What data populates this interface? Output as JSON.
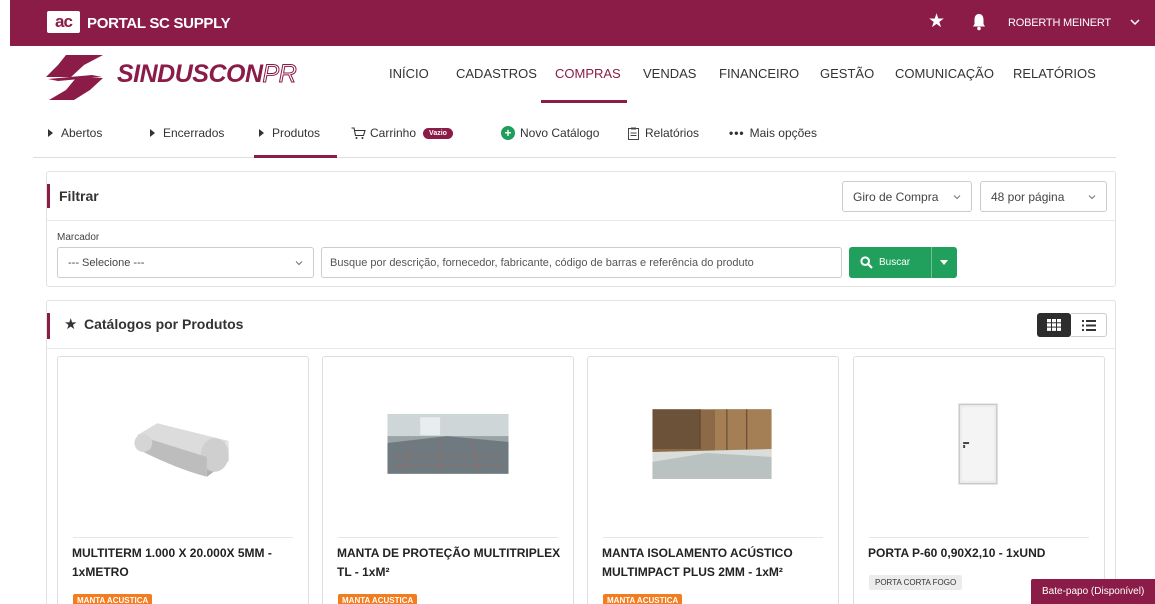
{
  "topbar": {
    "logo_mark": "ac",
    "portal_title": "PORTAL SC SUPPLY",
    "user_name": "ROBERTH MEINERT",
    "color": "#8a1c47"
  },
  "brand": {
    "name": "SINDUSCON",
    "suffix": "PR"
  },
  "main_nav": {
    "items": [
      "INÍCIO",
      "CADASTROS",
      "COMPRAS",
      "VENDAS",
      "FINANCEIRO",
      "GESTÃO",
      "COMUNICAÇÃO",
      "RELATÓRIOS"
    ],
    "active": "COMPRAS"
  },
  "sub_nav": {
    "abertos": "Abertos",
    "encerrados": "Encerrados",
    "produtos": "Produtos",
    "carrinho": "Carrinho",
    "carrinho_badge": "Vazio",
    "novo_catalogo": "Novo Catálogo",
    "relatorios": "Relatórios",
    "mais_opcoes": "Mais opções",
    "active": "Produtos"
  },
  "filter": {
    "title": "Filtrar",
    "sort_value": "Giro de Compra",
    "per_page_value": "48 por página",
    "marcador_label": "Marcador",
    "marcador_value": "--- Selecione ---",
    "search_placeholder": "Busque por descrição, fornecedor, fabricante, código de barras e referência do produto",
    "search_button": "Buscar"
  },
  "catalog": {
    "title": "Catálogos por Produtos",
    "view_mode": "grid",
    "products": [
      {
        "title": "MULTITERM 1.000 X 20.000X 5MM - 1xMETRO",
        "tag": "MANTA ACUSTICA",
        "image": "foam-roll-image"
      },
      {
        "title": "MANTA DE PROTEÇÃO MULTITRIPLEX TL - 1xM²",
        "tag": "MANTA ACUSTICA",
        "image": "floor-protection-image"
      },
      {
        "title": "MANTA ISOLAMENTO ACÚSTICO MULTIMPACT PLUS 2MM - 1xM²",
        "tag": "MANTA ACUSTICA",
        "image": "acoustic-floor-image"
      },
      {
        "title": "PORTA P-60 0,90X2,10 - 1xUND",
        "tag": "PORTA CORTA FOGO",
        "image": "fire-door-image"
      }
    ]
  },
  "chat": {
    "label": "Bate-papo (Disponível)"
  }
}
